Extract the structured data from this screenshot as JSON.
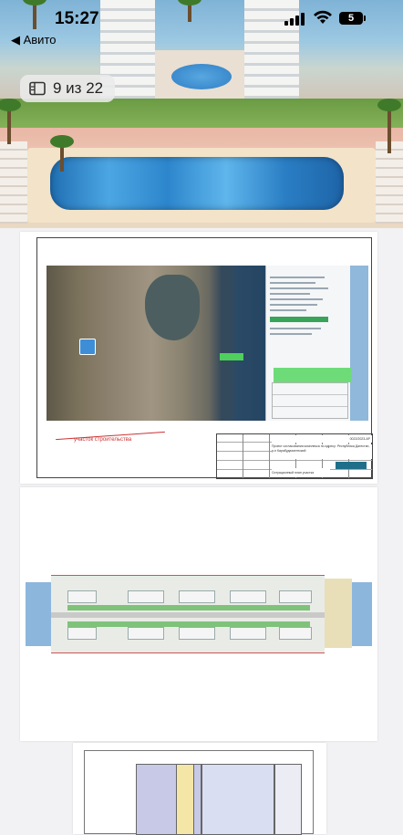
{
  "status_bar": {
    "time": "15:27",
    "battery": "5",
    "back_label": "◀ Авито"
  },
  "gallery": {
    "counter_text": "9 из 22",
    "counter_icon": "gallery-icon"
  },
  "pages": [
    {
      "legend": "участок строительства",
      "stamp_code": "0022/2023-АР",
      "stamp_title": "Проект согласования комплекса по адресу: Республика Дагестан, р-н Карабудахкентский",
      "stamp_sheet": "Ситуационный план участка"
    },
    {},
    {}
  ],
  "colors": {
    "accent_green": "#4fcf5c",
    "background": "#f2f2f4"
  }
}
